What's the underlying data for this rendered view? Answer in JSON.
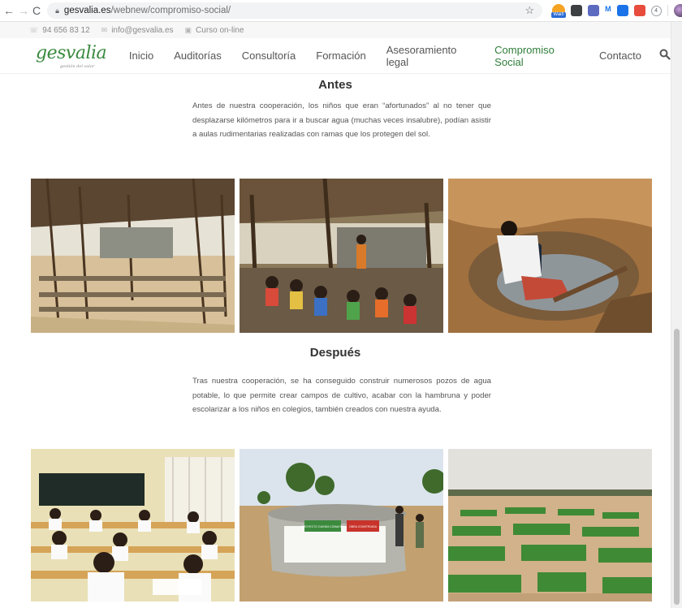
{
  "browser": {
    "url_host": "gesvalia.es",
    "url_path": "/webnew/compromiso-social/",
    "ext_wait_label": "Wait!",
    "ext_m_label": "M",
    "ext_ring_label": "4"
  },
  "topbar": {
    "phone": "94 656 83 12",
    "email": "info@gesvalia.es",
    "course": "Curso on-line"
  },
  "brand": {
    "name": "gesvalia",
    "tagline": "gestión del valor",
    "accent": "#2f7d3a"
  },
  "nav": {
    "items": [
      {
        "label": "Inicio"
      },
      {
        "label": "Auditorías"
      },
      {
        "label": "Consultoría"
      },
      {
        "label": "Formación"
      },
      {
        "label": "Asesoramiento legal"
      },
      {
        "label": "Compromiso Social"
      },
      {
        "label": "Contacto"
      }
    ],
    "active_index": 5
  },
  "sections": {
    "before": {
      "title": "Antes",
      "text": "Antes de nuestra cooperación, los niños que eran “afortunados” al no tener que desplazarse kilómetros para ir a buscar agua (muchas veces insalubre), podían asistir a aulas rudimentarias realizadas con ramas que los protegen del sol."
    },
    "after": {
      "title": "Después",
      "text": "Tras nuestra cooperación, se ha conseguido construir numerosos pozos de agua potable, lo que permite crear campos de cultivo, acabar con la hambruna y poder escolarizar a los niños en colegios, también creados con nuestra ayuda."
    }
  },
  "well_signs": {
    "green": "PROYECTO GUINEA CONAKRY",
    "red": "OBRA CONSTRUIDA"
  }
}
